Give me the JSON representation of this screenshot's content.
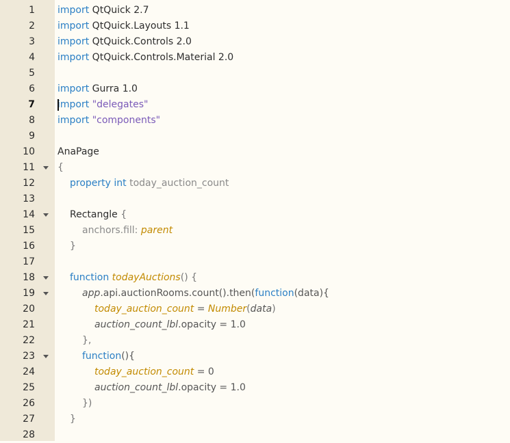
{
  "lines": [
    {
      "n": "1",
      "fold": false,
      "indent": 0,
      "tokens": [
        {
          "t": "import",
          "c": "kw"
        },
        {
          "t": " QtQuick 2.7",
          "c": "norm"
        }
      ]
    },
    {
      "n": "2",
      "fold": false,
      "indent": 0,
      "tokens": [
        {
          "t": "import",
          "c": "kw"
        },
        {
          "t": " QtQuick.Layouts 1.1",
          "c": "norm"
        }
      ]
    },
    {
      "n": "3",
      "fold": false,
      "indent": 0,
      "tokens": [
        {
          "t": "import",
          "c": "kw"
        },
        {
          "t": " QtQuick.Controls 2.0",
          "c": "norm"
        }
      ]
    },
    {
      "n": "4",
      "fold": false,
      "indent": 0,
      "tokens": [
        {
          "t": "import",
          "c": "kw"
        },
        {
          "t": " QtQuick.Controls.Material 2.0",
          "c": "norm"
        }
      ]
    },
    {
      "n": "5",
      "fold": false,
      "indent": 0,
      "tokens": []
    },
    {
      "n": "6",
      "fold": false,
      "indent": 0,
      "tokens": [
        {
          "t": "import",
          "c": "kw"
        },
        {
          "t": " Gurra 1.0",
          "c": "norm"
        }
      ]
    },
    {
      "n": "7",
      "fold": false,
      "indent": 0,
      "current": true,
      "tokens": [
        {
          "t": "import",
          "c": "kw"
        },
        {
          "t": " ",
          "c": "norm"
        },
        {
          "t": "\"delegates\"",
          "c": "str"
        }
      ]
    },
    {
      "n": "8",
      "fold": false,
      "indent": 0,
      "tokens": [
        {
          "t": "import",
          "c": "kw"
        },
        {
          "t": " ",
          "c": "norm"
        },
        {
          "t": "\"components\"",
          "c": "str"
        }
      ]
    },
    {
      "n": "9",
      "fold": false,
      "indent": 0,
      "tokens": []
    },
    {
      "n": "10",
      "fold": false,
      "indent": 0,
      "tokens": [
        {
          "t": "AnaPage",
          "c": "norm"
        }
      ]
    },
    {
      "n": "11",
      "fold": true,
      "indent": 0,
      "tokens": [
        {
          "t": "{",
          "c": "mut"
        }
      ]
    },
    {
      "n": "12",
      "fold": false,
      "indent": 1,
      "tokens": [
        {
          "t": "property",
          "c": "kw"
        },
        {
          "t": " ",
          "c": "norm"
        },
        {
          "t": "int",
          "c": "kw"
        },
        {
          "t": " today_auction_count",
          "c": "prop"
        }
      ]
    },
    {
      "n": "13",
      "fold": false,
      "indent": 0,
      "tokens": []
    },
    {
      "n": "14",
      "fold": true,
      "indent": 1,
      "tokens": [
        {
          "t": "Rectangle",
          "c": "norm"
        },
        {
          "t": " {",
          "c": "mut"
        }
      ]
    },
    {
      "n": "15",
      "fold": false,
      "indent": 2,
      "tokens": [
        {
          "t": "anchors.fill:",
          "c": "prop"
        },
        {
          "t": " ",
          "c": "norm"
        },
        {
          "t": "parent",
          "c": "fn"
        }
      ]
    },
    {
      "n": "16",
      "fold": false,
      "indent": 1,
      "tokens": [
        {
          "t": "}",
          "c": "mut"
        }
      ]
    },
    {
      "n": "17",
      "fold": false,
      "indent": 0,
      "tokens": []
    },
    {
      "n": "18",
      "fold": true,
      "indent": 1,
      "tokens": [
        {
          "t": "function",
          "c": "kw"
        },
        {
          "t": " ",
          "c": "norm"
        },
        {
          "t": "todayAuctions",
          "c": "fn"
        },
        {
          "t": "() {",
          "c": "mut"
        }
      ]
    },
    {
      "n": "19",
      "fold": true,
      "indent": 2,
      "tokens": [
        {
          "t": "app",
          "c": "ital"
        },
        {
          "t": ".api.auctionRooms.count().then(",
          "c": "plain"
        },
        {
          "t": "function",
          "c": "kw"
        },
        {
          "t": "(data){",
          "c": "plain"
        }
      ]
    },
    {
      "n": "20",
      "fold": false,
      "indent": 3,
      "tokens": [
        {
          "t": "today_auction_count",
          "c": "fn"
        },
        {
          "t": " = ",
          "c": "plain"
        },
        {
          "t": "Number",
          "c": "fn"
        },
        {
          "t": "(",
          "c": "mut"
        },
        {
          "t": "data",
          "c": "ital"
        },
        {
          "t": ")",
          "c": "mut"
        }
      ]
    },
    {
      "n": "21",
      "fold": false,
      "indent": 3,
      "tokens": [
        {
          "t": "auction_count_lbl",
          "c": "ital"
        },
        {
          "t": ".opacity = 1.0",
          "c": "plain"
        }
      ]
    },
    {
      "n": "22",
      "fold": false,
      "indent": 2,
      "tokens": [
        {
          "t": "},",
          "c": "mut"
        }
      ]
    },
    {
      "n": "23",
      "fold": true,
      "indent": 2,
      "tokens": [
        {
          "t": "function",
          "c": "kw"
        },
        {
          "t": "(){",
          "c": "plain"
        }
      ]
    },
    {
      "n": "24",
      "fold": false,
      "indent": 3,
      "tokens": [
        {
          "t": "today_auction_count",
          "c": "fn"
        },
        {
          "t": " = 0",
          "c": "plain"
        }
      ]
    },
    {
      "n": "25",
      "fold": false,
      "indent": 3,
      "tokens": [
        {
          "t": "auction_count_lbl",
          "c": "ital"
        },
        {
          "t": ".opacity = 1.0",
          "c": "plain"
        }
      ]
    },
    {
      "n": "26",
      "fold": false,
      "indent": 2,
      "tokens": [
        {
          "t": "})",
          "c": "mut"
        }
      ]
    },
    {
      "n": "27",
      "fold": false,
      "indent": 1,
      "tokens": [
        {
          "t": "}",
          "c": "mut"
        }
      ]
    },
    {
      "n": "28",
      "fold": false,
      "indent": 0,
      "tokens": []
    }
  ],
  "colors": {
    "keyword": "#2a7fc5",
    "string": "#7a5ab8",
    "property": "#8a8a8a",
    "function": "#c28a00",
    "gutter_bg": "#efe9d9",
    "editor_bg": "#fefcf5"
  },
  "icons": {
    "fold": "fold-arrow-icon"
  }
}
